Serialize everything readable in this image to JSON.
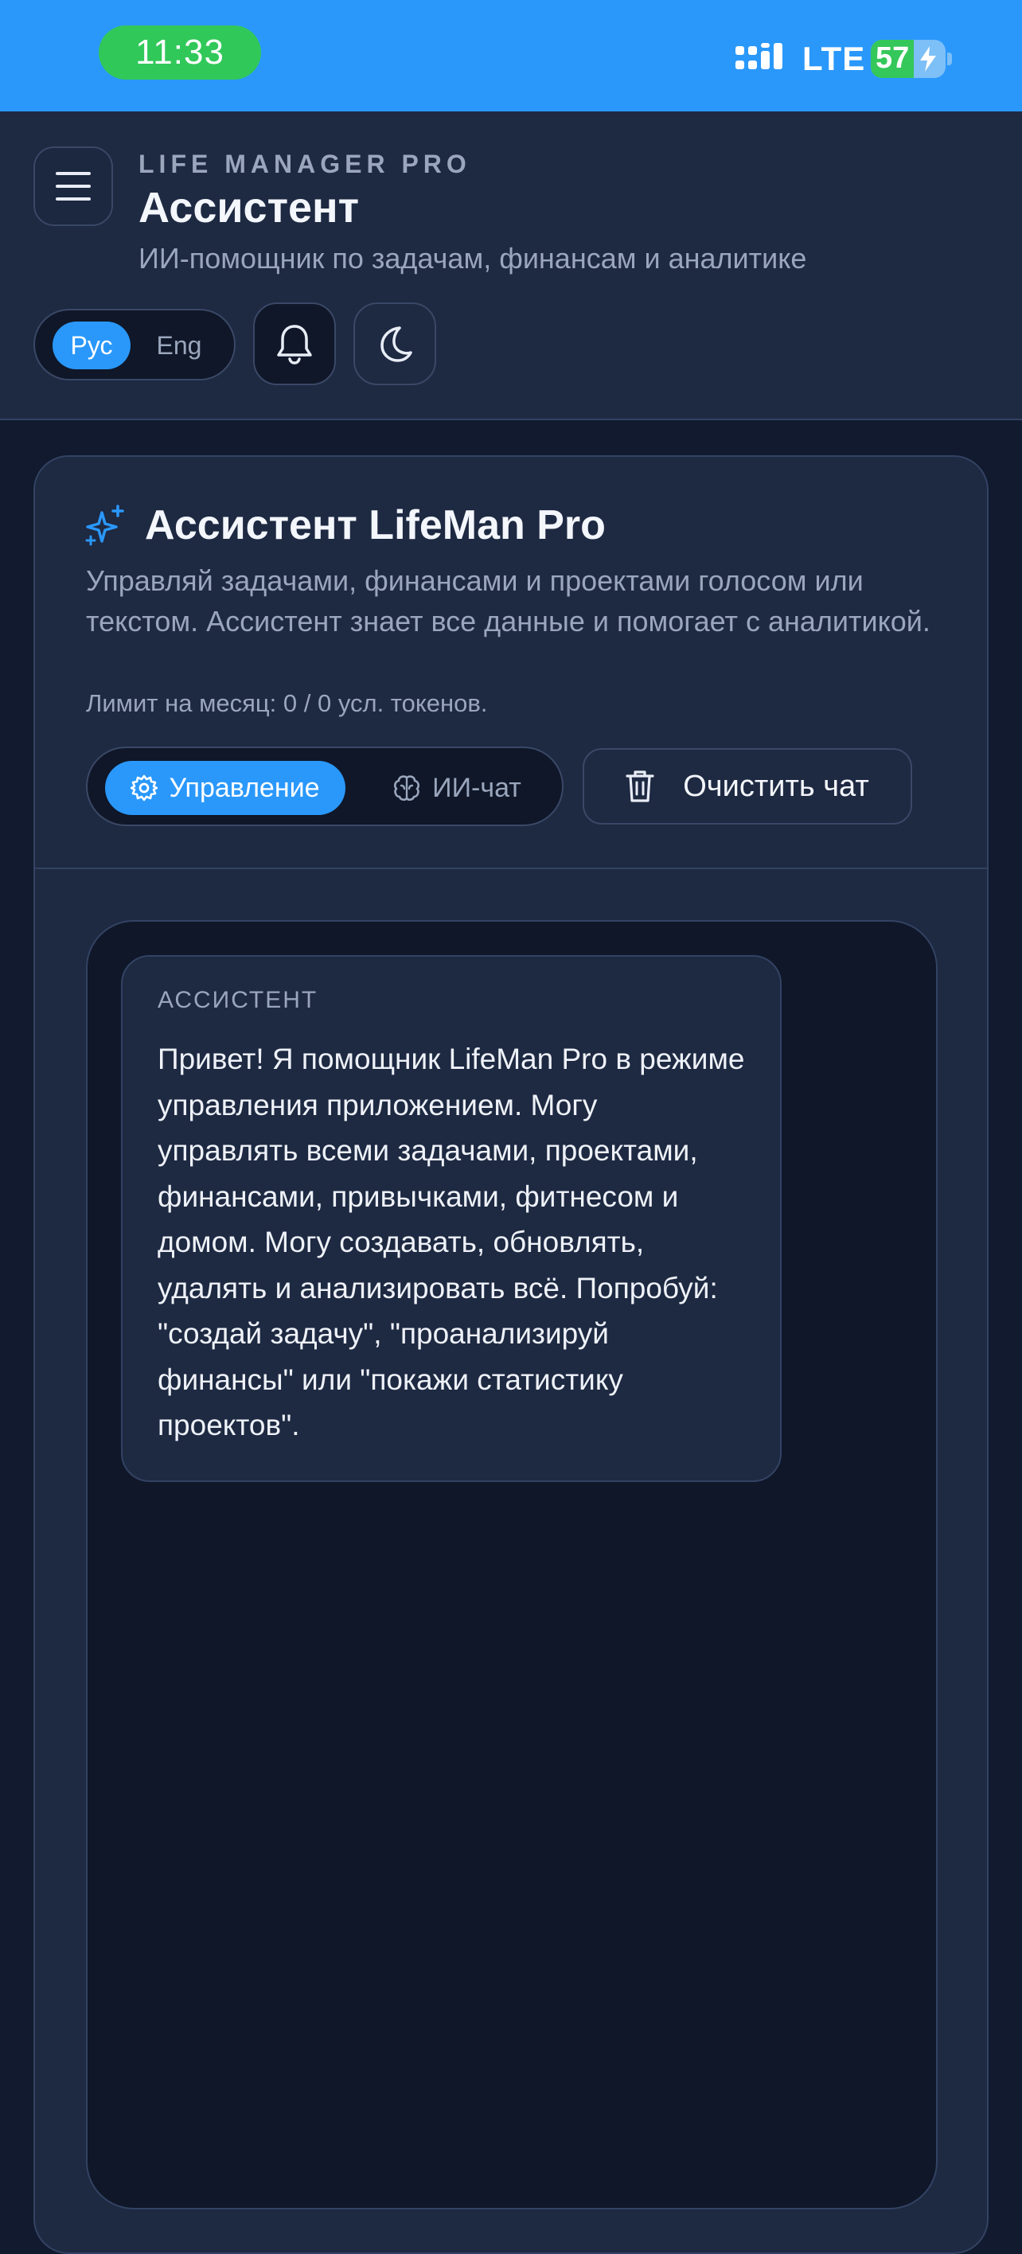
{
  "status_bar": {
    "time": "11:33",
    "network": "LTE",
    "battery": "57",
    "battery_level": 0.57,
    "colors": {
      "bar": "#2a98fb",
      "time_pill": "#31c85a",
      "battery": "#34c759"
    }
  },
  "header": {
    "eyebrow": "LIFE MANAGER PRO",
    "title": "Ассистент",
    "subtitle": "ИИ-помощник по задачам, финансам и аналитике",
    "lang": {
      "rus": "Рус",
      "eng": "Eng",
      "selected": "Рус"
    }
  },
  "assistant": {
    "title": "Ассистент LifeMan Pro",
    "description": "Управляй задачами, финансами и проектами голосом или текстом. Ассистент знает все данные и помогает с аналитикой.",
    "limit": "Лимит на месяц: 0 / 0 усл. токенов.",
    "modes": {
      "control": "Управление",
      "chat": "ИИ-чат",
      "selected": "Управление"
    },
    "clear_label": "Очистить чат"
  },
  "chat": {
    "messages": [
      {
        "sender": "АССИСТЕНТ",
        "text": "Привет! Я помощник LifeMan Pro в режиме управления приложением. Могу управлять всеми задачами, проектами, финансами, привычками, фитнесом и домом. Могу создавать, обновлять, удалять и анализировать всё. Попробуй: \"создай задачу\", \"проанализируй финансы\" или \"покажи статистику проектов\"."
      }
    ]
  },
  "icons": {
    "menu": "menu-icon",
    "bell": "bell-icon",
    "theme": "moon-icon",
    "assistant": "sparkles-icon",
    "control": "gear-icon",
    "chat": "brain-icon",
    "clear": "trash-icon"
  },
  "colors": {
    "accent": "#2a98fb",
    "background": "#111a2e",
    "surface": "#1e2942"
  }
}
